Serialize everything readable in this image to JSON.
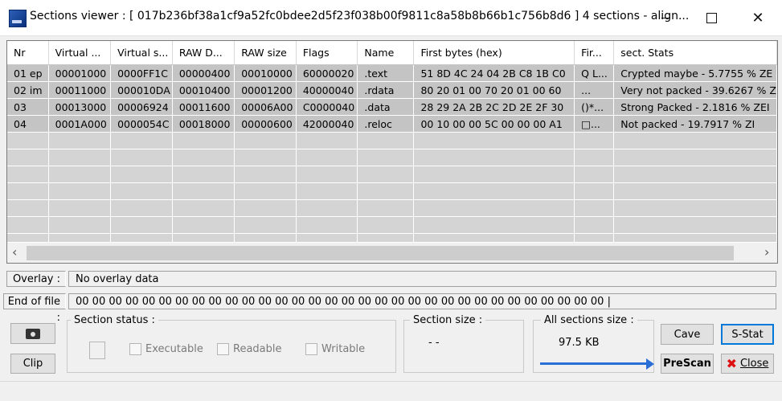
{
  "window": {
    "title": "Sections viewer :  [ 017b236bf38a1cf9a52fc0bdee2d5f23f038b00f9811c8a58b8b66b1c756b8d6 ] 4 sections - align..."
  },
  "table": {
    "columns": [
      "Nr",
      "Virtual ...",
      "Virtual s...",
      "RAW D...",
      "RAW size",
      "Flags",
      "Name",
      "First bytes (hex)",
      "Fir...",
      "sect. Stats"
    ],
    "rows": [
      [
        "01 ep",
        "00001000",
        "0000FF1C",
        "00000400",
        "00010000",
        "60000020",
        ".text",
        "51 8D 4C 24 04 2B C8 1B C0",
        "Q L...",
        "Crypted maybe  - 5.7755 % ZE"
      ],
      [
        "02 im",
        "00011000",
        "000010DA",
        "00010400",
        "00001200",
        "40000040",
        ".rdata",
        "80 20 01 00 70 20 01 00 60",
        "...",
        "Very not packed - 39.6267 % Z"
      ],
      [
        "03",
        "00013000",
        "00006924",
        "00011600",
        "00006A00",
        "C0000040",
        ".data",
        "28 29 2A 2B 2C 2D 2E 2F 30",
        "()*...",
        "Strong Packed  - 2.1816 % ZEI"
      ],
      [
        "04",
        "0001A000",
        "0000054C",
        "00018000",
        "00000600",
        "42000040",
        ".reloc",
        "00 10 00 00 5C 00 00 00 A1",
        "□...",
        "Not packed           - 19.7917 % ZI"
      ]
    ]
  },
  "overlay": {
    "label": "Overlay :",
    "value": "No overlay data"
  },
  "eof": {
    "label": "End of file :",
    "value": "00 00 00 00 00 00 00 00 00 00 00 00 00 00 00 00 00 00 00 00 00 00 00 00 00 00 00 00 00 00 00 00  |"
  },
  "section_status": {
    "label": "Section status :",
    "executable": "Executable",
    "readable": "Readable",
    "writable": "Writable"
  },
  "section_size": {
    "label": "Section size :",
    "value": "- -"
  },
  "all_sections_size": {
    "label": "All sections size :",
    "value": "97.5 KB"
  },
  "buttons": {
    "clip": "Clip",
    "cave": "Cave",
    "sstat": "S-Stat",
    "prescan": "PreScan",
    "close": "Close"
  },
  "colors": {
    "accent": "#0078d7",
    "arrow": "#2a6fd6",
    "row_bg": "#c4c4c4",
    "empty_row_bg": "#d4d4d4"
  }
}
